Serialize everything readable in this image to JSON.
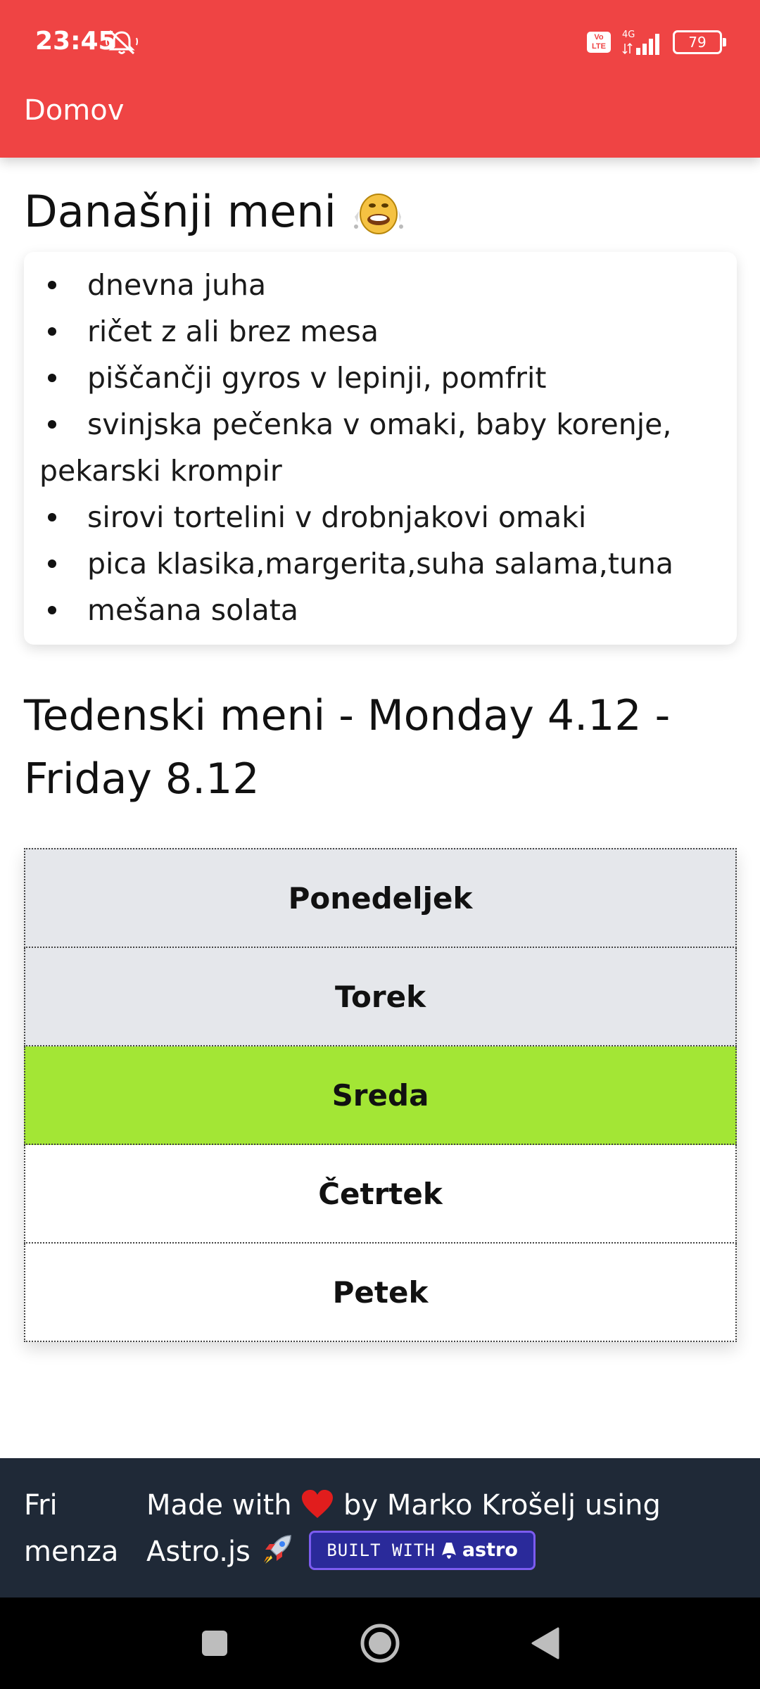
{
  "status_bar": {
    "time": "23:45",
    "network": "4G",
    "battery": "79",
    "volte_line1": "Vo",
    "volte_line2": "LTE"
  },
  "app_bar": {
    "title": "Domov"
  },
  "today": {
    "heading": "Današnji meni",
    "items": [
      "dnevna juha",
      "ričet z ali brez mesa",
      "piščančji gyros v lepinji, pomfrit",
      "svinjska pečenka v omaki, baby korenje, pekarski krompir",
      "sirovi tortelini v drobnjakovi omaki",
      "pica klasika,margerita,suha salama,tuna",
      "mešana solata"
    ]
  },
  "week": {
    "heading": "Tedenski meni - Monday 4.12 - Friday 8.12",
    "days": [
      "Ponedeljek",
      "Torek",
      "Sreda",
      "Četrtek",
      "Petek"
    ],
    "current_day": "Sreda"
  },
  "footer": {
    "brand": "Fri menza",
    "credit_part1": "Made with",
    "credit_part2": "by Marko Krošelj using Astro.js",
    "badge_prefix": "BUILT WITH",
    "badge_name": "astro"
  },
  "colors": {
    "app_bar": "#ef4444",
    "past_day": "#e5e7eb",
    "current_day": "#a3e635",
    "footer": "#1f2937",
    "badge": "#2a2a9a"
  }
}
